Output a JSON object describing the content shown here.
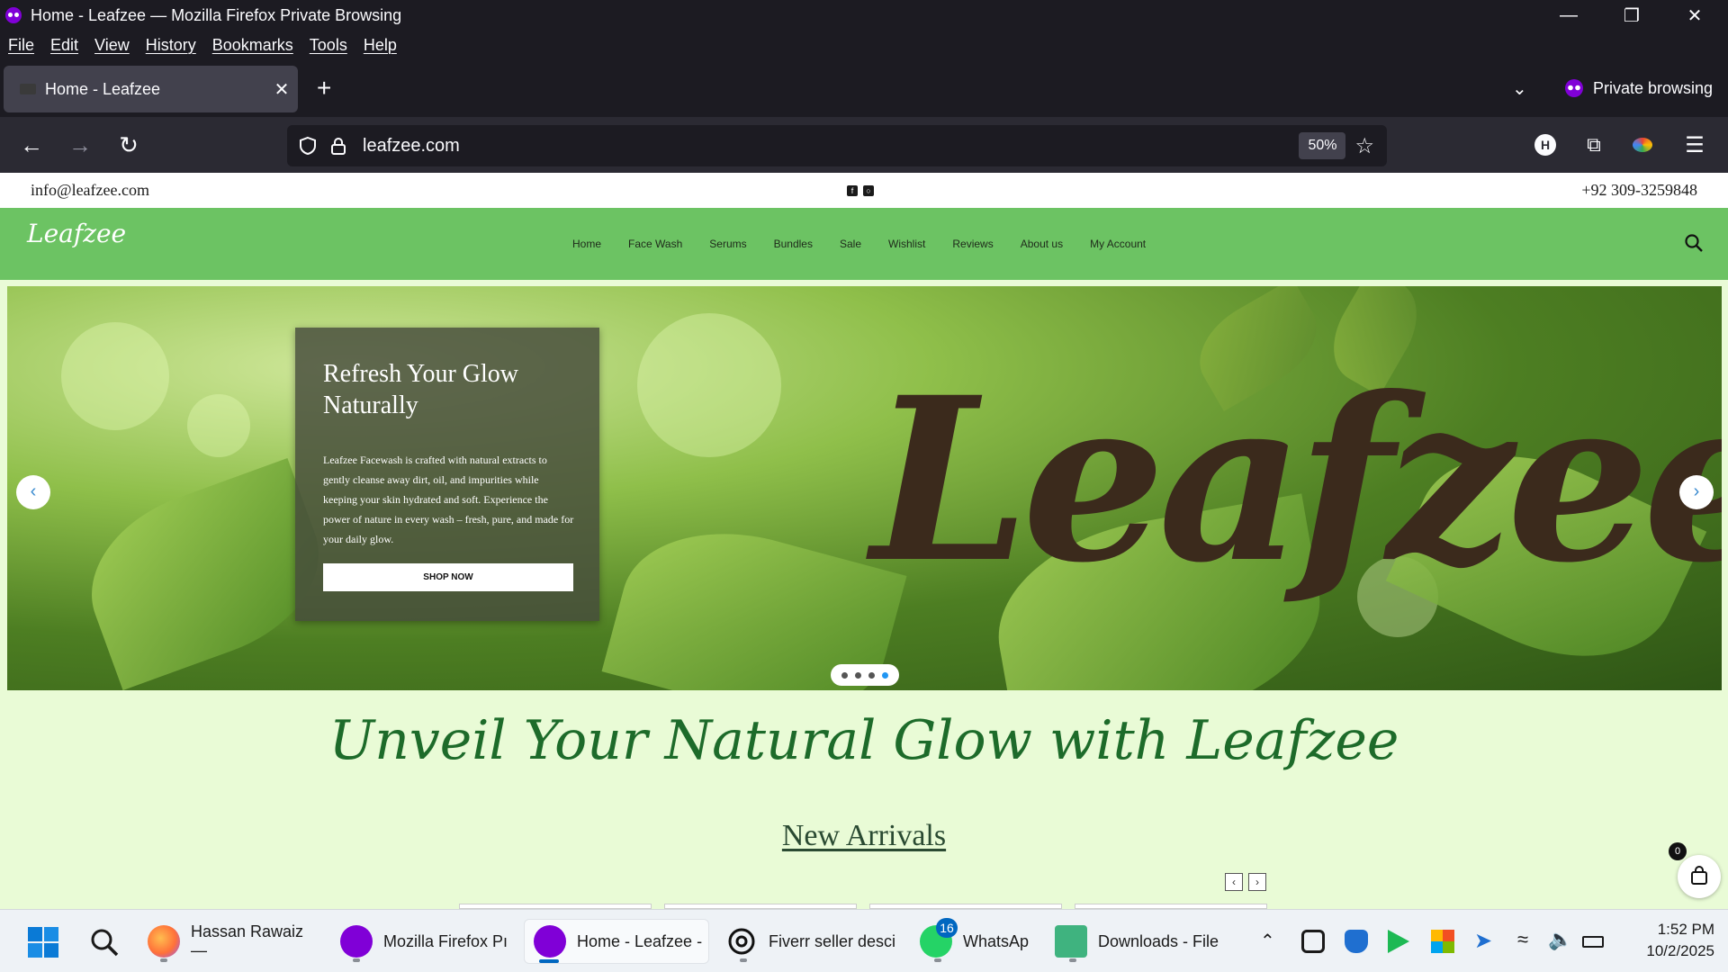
{
  "window": {
    "title": "Home - Leafzee — Mozilla Firefox Private Browsing",
    "menu": [
      "File",
      "Edit",
      "View",
      "History",
      "Bookmarks",
      "Tools",
      "Help"
    ]
  },
  "tabs": [
    {
      "label": "Home - Leafzee"
    }
  ],
  "private_label": "Private browsing",
  "urlbar": {
    "url": "leafzee.com",
    "zoom": "50%"
  },
  "toolbar": {
    "account_initial": "H"
  },
  "site": {
    "email": "info@leafzee.com",
    "phone": "+92 309-3259848",
    "logo": "Leafzee",
    "nav": [
      "Home",
      "Face Wash",
      "Serums",
      "Bundles",
      "Sale",
      "Wishlist",
      "Reviews",
      "About us",
      "My Account"
    ],
    "hero": {
      "title": "Refresh Your Glow Naturally",
      "body": "Leafzee Facewash is crafted with natural extracts to gently cleanse away dirt, oil, and impurities while keeping your skin hydrated and soft. Experience the power of nature in every wash – fresh, pure, and made for your daily glow.",
      "cta": "SHOP NOW",
      "brand_text": "Leafzee",
      "slide_count": 4,
      "active_slide": 4
    },
    "tagline": "Unveil Your Natural Glow with Leafzee",
    "section_title": "New Arrivals",
    "cart_count": "0"
  },
  "taskbar": {
    "items": [
      {
        "label": "Hassan Rawaiz —"
      },
      {
        "label": "Mozilla Firefox Pı"
      },
      {
        "label": "Home - Leafzee -"
      },
      {
        "label": "Fiverr seller desci"
      },
      {
        "label": "WhatsAp",
        "badge": "16"
      },
      {
        "label": "Downloads - File"
      }
    ],
    "time": "1:52 PM",
    "date": "10/2/2025"
  },
  "colors": {
    "header_green": "#6cc363",
    "page_bg": "#e9fbd6",
    "tagline": "#1d6b2a",
    "private_purple": "#8000d7"
  }
}
